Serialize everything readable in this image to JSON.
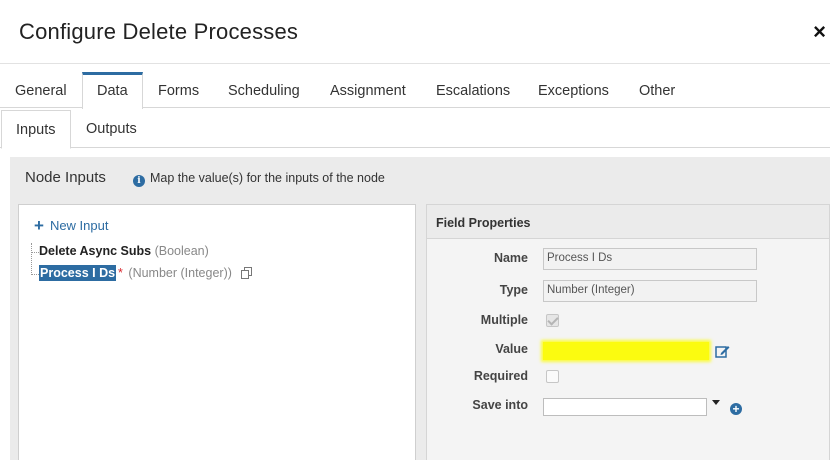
{
  "dialog": {
    "title": "Configure Delete Processes",
    "close_label": "×"
  },
  "main_tabs": [
    {
      "label": "General"
    },
    {
      "label": "Data",
      "active": true
    },
    {
      "label": "Forms"
    },
    {
      "label": "Scheduling"
    },
    {
      "label": "Assignment"
    },
    {
      "label": "Escalations"
    },
    {
      "label": "Exceptions"
    },
    {
      "label": "Other"
    }
  ],
  "sub_tabs": [
    {
      "label": "Inputs",
      "active": true
    },
    {
      "label": "Outputs"
    }
  ],
  "node_inputs": {
    "title": "Node Inputs",
    "info_icon": "i",
    "info_text": "Map the value(s) for the inputs of the node",
    "new_input_icon": "+",
    "new_input_label": "New Input",
    "items": [
      {
        "name": "Delete Async Subs",
        "type": "(Boolean)",
        "required": false
      },
      {
        "name": "Process I Ds",
        "type": "(Number (Integer))",
        "required": true,
        "required_marker": "*",
        "selected": true
      }
    ]
  },
  "field_properties": {
    "title": "Field Properties",
    "name_label": "Name",
    "name_value": "Process I Ds",
    "type_label": "Type",
    "type_value": "Number (Integer)",
    "multiple_label": "Multiple",
    "multiple_checked": true,
    "value_label": "Value",
    "value_value": "",
    "required_label": "Required",
    "required_checked": false,
    "save_into_label": "Save into",
    "save_into_value": "",
    "add_icon": "+"
  },
  "colors": {
    "accent": "#2d6ca2",
    "highlight": "#fbfb10",
    "required": "#d9282f"
  }
}
